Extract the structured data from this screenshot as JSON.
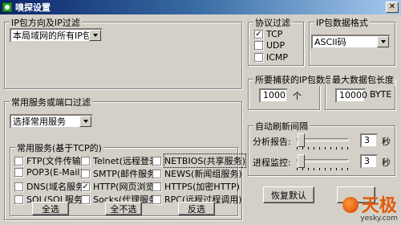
{
  "window": {
    "title": "嗅探设置",
    "close_glyph": "✕"
  },
  "ip_group": {
    "title": "IP包方向及IP过滤",
    "selected": "本局域网的所有IP包"
  },
  "protocol_group": {
    "title": "协议过滤",
    "items": [
      {
        "label": "TCP",
        "checked": true
      },
      {
        "label": "UDP",
        "checked": false
      },
      {
        "label": "ICMP",
        "checked": false
      }
    ]
  },
  "format_group": {
    "title": "IP包数据格式",
    "selected": "ASCII码"
  },
  "capture_count": {
    "title": "所要捕获的IP包数目",
    "value": "1000",
    "unit": "个"
  },
  "max_length": {
    "title": "最大数据包长度",
    "value": "10000",
    "unit": "BYTE"
  },
  "service_group": {
    "title": "常用服务或端口过滤",
    "selected": "选择常用服务"
  },
  "tcp_services": {
    "title": "常用服务(基于TCP的)",
    "items": [
      {
        "label": "FTP(文件传输)",
        "checked": false
      },
      {
        "label": "Telnet(远程登录)",
        "checked": false
      },
      {
        "label": "NETBIOS(共享服务)",
        "checked": false
      },
      {
        "label": "POP3(E-Mail)",
        "checked": false
      },
      {
        "label": "SMTP(邮件服务)",
        "checked": false
      },
      {
        "label": "NEWS(新闻组服务)",
        "checked": false
      },
      {
        "label": "DNS(域名服务)",
        "checked": false
      },
      {
        "label": "HTTP(网页浏览)",
        "checked": true
      },
      {
        "label": "HTTPS(加密HTTP)",
        "checked": false
      },
      {
        "label": "SQL(SQL服务)",
        "checked": false
      },
      {
        "label": "Socks(代理服务)",
        "checked": false
      },
      {
        "label": "RPC(远程过程调用)",
        "checked": false
      }
    ],
    "select_all": "全选",
    "select_none": "全不选",
    "invert": "反选"
  },
  "refresh_group": {
    "title": "自动刷新间隔",
    "analysis_label": "分析报告:",
    "analysis_value": "3",
    "analysis_unit": "秒",
    "process_label": "进程监控:",
    "process_value": "3",
    "process_unit": "秒"
  },
  "buttons": {
    "restore_default": "恢复默认"
  },
  "watermark": {
    "main": "天极",
    "sub": "yesky.com"
  }
}
